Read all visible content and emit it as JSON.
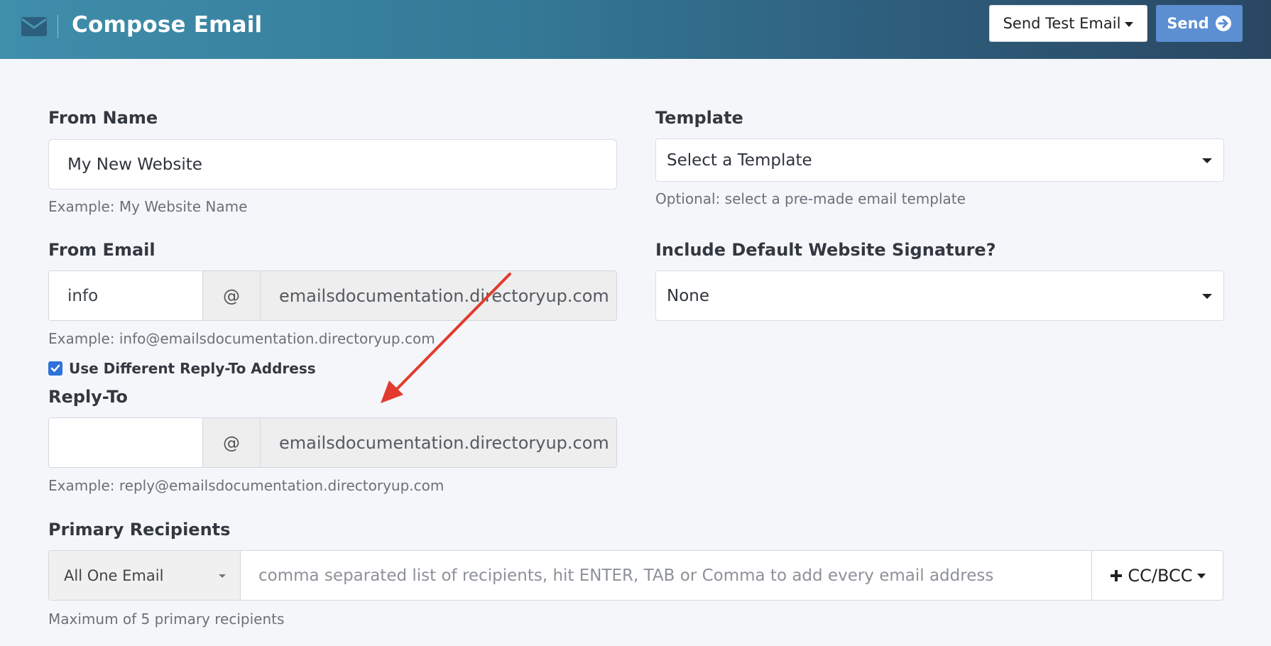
{
  "header": {
    "title": "Compose Email",
    "send_test_label": "Send Test Email",
    "send_label": "Send",
    "gradient_start": "#3f8eab",
    "gradient_end": "#2a4762",
    "send_color": "#5b8fd2"
  },
  "from_name": {
    "label": "From Name",
    "value": "My New Website",
    "help": "Example: My Website Name"
  },
  "from_email": {
    "label": "From Email",
    "local_value": "info",
    "at": "@",
    "domain": "emailsdocumentation.directoryup.com",
    "help": "Example: info@emailsdocumentation.directoryup.com"
  },
  "reply_to_toggle": {
    "label": "Use Different Reply-To Address",
    "checked": true
  },
  "reply_to": {
    "label": "Reply-To",
    "local_value": "",
    "at": "@",
    "domain": "emailsdocumentation.directoryup.com",
    "help": "Example: reply@emailsdocumentation.directoryup.com"
  },
  "template": {
    "label": "Template",
    "selected": "Select a Template",
    "help": "Optional: select a pre-made email template"
  },
  "signature": {
    "label": "Include Default Website Signature?",
    "selected": "None"
  },
  "primary_recipients": {
    "label": "Primary Recipients",
    "mode": "All One Email",
    "placeholder": "comma separated list of recipients, hit ENTER, TAB or Comma to add every email address",
    "cc_bcc_label": "CC/BCC",
    "help": "Maximum of 5 primary recipients"
  },
  "annotation": {
    "arrow_color": "#e23b2e"
  },
  "icons": [
    "envelope-icon",
    "caret-down-icon",
    "arrow-circle-right-icon",
    "check-icon",
    "plus-icon"
  ]
}
